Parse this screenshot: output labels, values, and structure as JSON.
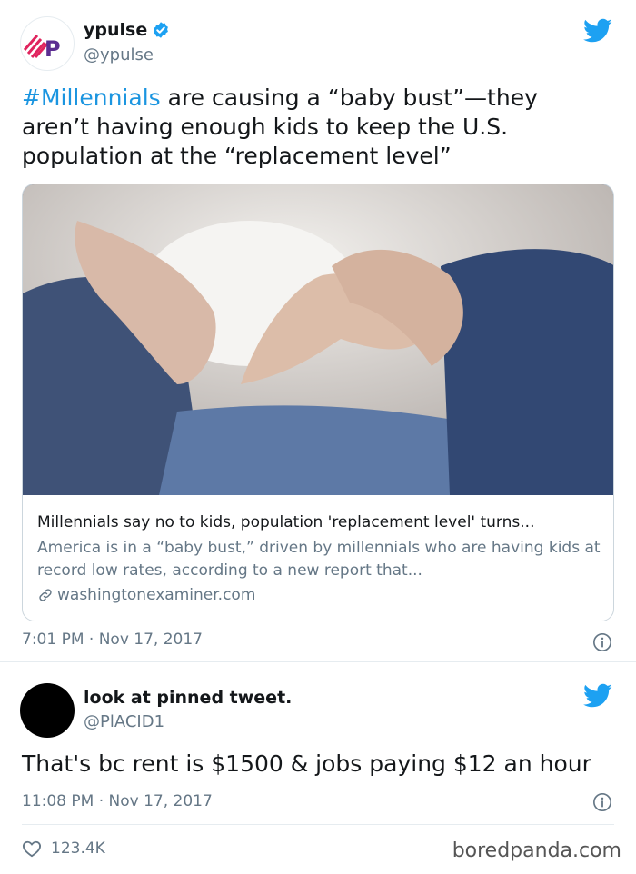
{
  "tweet1": {
    "name": "ypulse",
    "handle": "@ypulse",
    "logo_text": "YP",
    "text_hashtag": "#Millennials",
    "text_body": " are causing a “baby bust”—they aren’t having enough kids to keep the U.S. population at the “replacement level”",
    "card": {
      "title": "Millennials say no to kids, population 'replacement level' turns...",
      "description": "America is in a “baby bust,” driven by millennials who are having kids at record low rates, according to a new report that...",
      "domain": "washingtonexaminer.com"
    },
    "timestamp": "7:01 PM · Nov 17, 2017"
  },
  "tweet2": {
    "name": "look at pinned tweet.",
    "handle": "@PlACID1",
    "text": "That's bc rent is $1500 & jobs paying $12 an hour",
    "timestamp": "11:08 PM · Nov 17, 2017",
    "likes": "123.4K"
  },
  "watermark": "boredpanda.com",
  "colors": {
    "twitter_blue": "#1da1f2",
    "hashtag": "#1b95e0",
    "logo_red": "#e0245e",
    "logo_purple": "#5c2d91"
  },
  "icons": {
    "bird": "twitter-bird-icon",
    "verified": "verified-badge-icon",
    "info": "info-icon",
    "link": "link-icon",
    "heart": "heart-icon"
  }
}
